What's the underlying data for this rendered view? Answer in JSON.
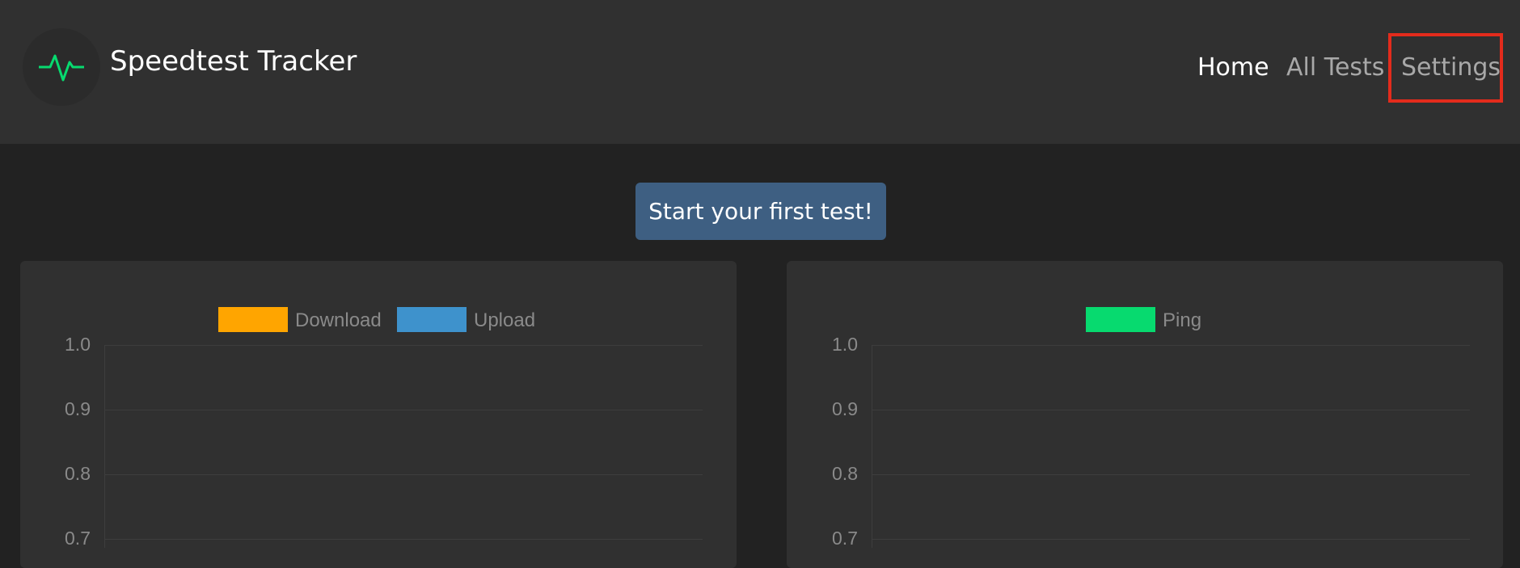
{
  "header": {
    "brand": "Speedtest Tracker",
    "logo_icon": "activity-pulse-icon",
    "nav": {
      "home": "Home",
      "all_tests": "All Tests",
      "settings": "Settings"
    }
  },
  "main": {
    "start_button": "Start your first test!"
  },
  "colors": {
    "download": "#ffa500",
    "upload": "#3e92cc",
    "ping": "#07da6f",
    "highlight": "#e32b1c",
    "button": "#3e5f82"
  },
  "chart_data": [
    {
      "type": "line",
      "series": [
        {
          "name": "Download",
          "values": []
        },
        {
          "name": "Upload",
          "values": []
        }
      ],
      "ylim": [
        0.7,
        1.0
      ],
      "yticks": [
        "1.0",
        "0.9",
        "0.8",
        "0.7"
      ],
      "legend": "top-center",
      "grid": true
    },
    {
      "type": "line",
      "series": [
        {
          "name": "Ping",
          "values": []
        }
      ],
      "ylim": [
        0.7,
        1.0
      ],
      "yticks": [
        "1.0",
        "0.9",
        "0.8",
        "0.7"
      ],
      "legend": "top-center",
      "grid": true
    }
  ]
}
